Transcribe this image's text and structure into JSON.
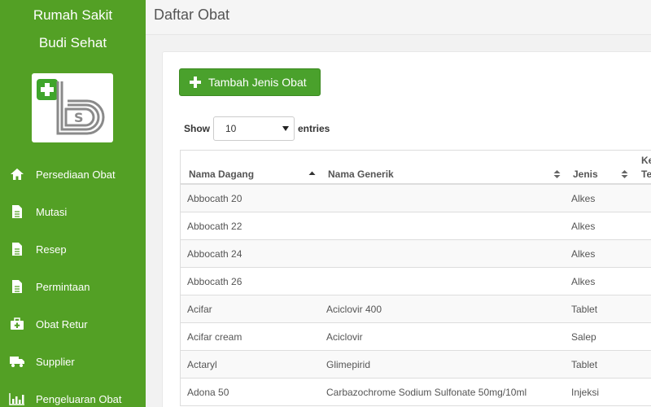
{
  "sidebar": {
    "brand_line1": "Rumah Sakit",
    "brand_line2": "Budi Sehat",
    "accent_color": "#53a025",
    "items": [
      {
        "label": "Persediaan Obat",
        "icon": "home-icon"
      },
      {
        "label": "Mutasi",
        "icon": "document-icon"
      },
      {
        "label": "Resep",
        "icon": "document-icon"
      },
      {
        "label": "Permintaan",
        "icon": "document-icon"
      },
      {
        "label": "Obat Retur",
        "icon": "medkit-icon"
      },
      {
        "label": "Supplier",
        "icon": "truck-icon"
      },
      {
        "label": "Pengeluaran Obat",
        "icon": "bar-chart-icon"
      }
    ]
  },
  "header": {
    "title": "Daftar Obat"
  },
  "toolbar": {
    "add_label": "Tambah Jenis Obat"
  },
  "length_control": {
    "show_label": "Show",
    "selected": "10",
    "entries_label": "entries"
  },
  "table": {
    "columns": [
      "Nama Dagang",
      "Nama Generik",
      "Jenis"
    ],
    "extra_col_line1": "Ke",
    "extra_col_line2": "Te",
    "rows": [
      [
        "Abbocath 20",
        "",
        "Alkes"
      ],
      [
        "Abbocath 22",
        "",
        "Alkes"
      ],
      [
        "Abbocath 24",
        "",
        "Alkes"
      ],
      [
        "Abbocath 26",
        "",
        "Alkes"
      ],
      [
        "Acifar",
        "Aciclovir 400",
        "Tablet"
      ],
      [
        "Acifar cream",
        "Aciclovir",
        "Salep"
      ],
      [
        "Actaryl",
        "Glimepirid",
        "Tablet"
      ],
      [
        "Adona 50",
        "Carbazochrome Sodium Sulfonate 50mg/10ml",
        "Injeksi"
      ]
    ]
  }
}
